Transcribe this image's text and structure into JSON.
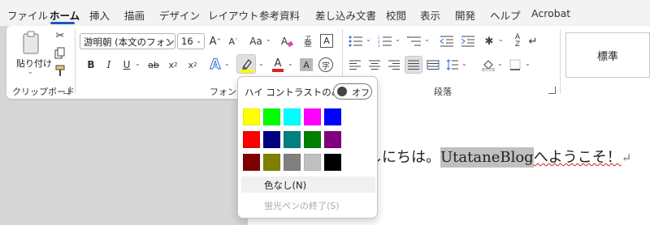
{
  "menu": {
    "tabs": [
      "ファイル",
      "ホーム",
      "挿入",
      "描画",
      "デザイン",
      "レイアウト",
      "参考資料",
      "差し込み文書",
      "校閲",
      "表示",
      "開発",
      "ヘルプ",
      "Acrobat"
    ],
    "active": "ホーム"
  },
  "ribbon": {
    "clipboard": {
      "paste_label": "貼り付け",
      "group_label": "クリップボード"
    },
    "font": {
      "name": "游明朝 (本文のフォント",
      "size": "16",
      "group_label": "フォント",
      "aa_label": "Aa"
    },
    "paragraph": {
      "group_label": "段落"
    },
    "styles": {
      "normal_label": "標準"
    }
  },
  "highlight_menu": {
    "high_contrast_label": "ハイ コントラストのみ(H)",
    "toggle_state": "オフ",
    "colors": [
      "#ffff00",
      "#00ff00",
      "#00ffff",
      "#ff00ff",
      "#0000ff",
      "#ff0000",
      "#000080",
      "#008080",
      "#008000",
      "#800080",
      "#800000",
      "#808000",
      "#808080",
      "#c0c0c0",
      "#000000"
    ],
    "no_color_label": "色なし(N)",
    "end_pen_label": "蛍光ペンの終了(S)"
  },
  "document": {
    "text_before": "しにちは。",
    "highlighted": "UtataneBlog",
    "text_after": "へようこそ！",
    "para_mark": "↵"
  },
  "colors": {
    "accent": "#185abd",
    "highlight_current": "#ffff00",
    "font_color_current": "#e02020"
  }
}
